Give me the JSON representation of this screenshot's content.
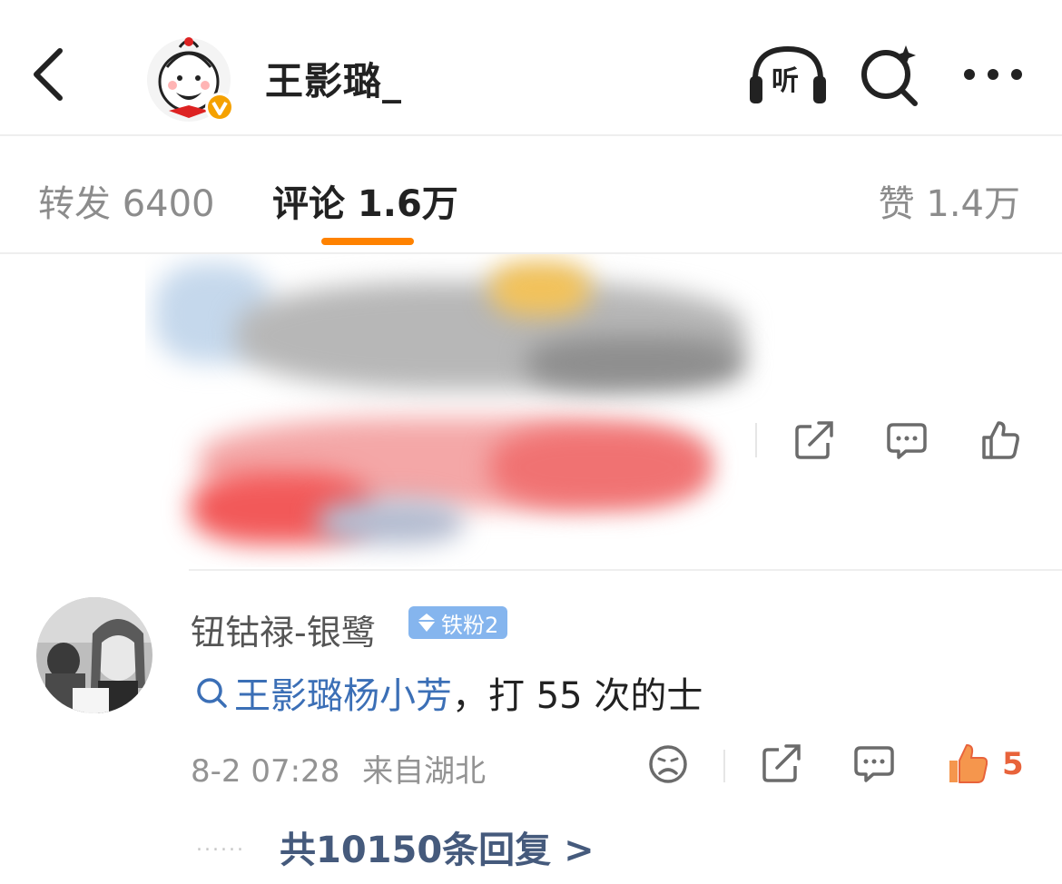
{
  "header": {
    "username": "王影璐_",
    "listen_label": "听",
    "icons": [
      "back-arrow-icon",
      "listen-headphones-icon",
      "ai-search-icon",
      "more-dots-icon"
    ]
  },
  "tabs": {
    "repost": "转发 6400",
    "comments": "评论 1.6万",
    "likes": "赞 1.4万",
    "active": "comments",
    "accent_color": "#ff8200"
  },
  "comment": {
    "author": "钮钴禄-银鹭",
    "badge": "铁粉2",
    "topic": "王影璐杨小芳",
    "text": "，打 55 次的士",
    "time": "8-2 07:28",
    "location": "来自湖北",
    "like_count": "5",
    "dots": "......",
    "replies_label": "共10150条回复 >"
  },
  "colors": {
    "link": "#3b6fb6",
    "like_active": "#e8633b",
    "badge": "#85b5ee"
  }
}
